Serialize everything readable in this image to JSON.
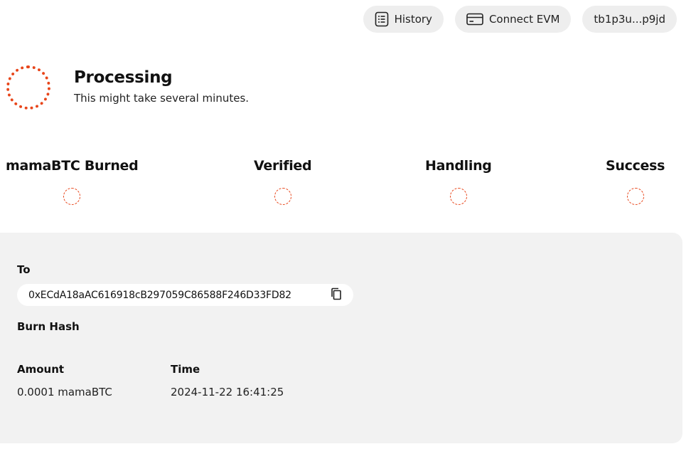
{
  "header": {
    "history_label": "History",
    "connect_label": "Connect EVM",
    "wallet_label": "tb1p3u...p9jd"
  },
  "status": {
    "title": "Processing",
    "subtitle": "This might take several minutes."
  },
  "steps": [
    {
      "label": "mamaBTC Burned"
    },
    {
      "label": "Verified"
    },
    {
      "label": "Handling"
    },
    {
      "label": "Success"
    }
  ],
  "details": {
    "to_label": "To",
    "to_address": "0xECdA18aAC616918cB297059C86588F246D33FD82",
    "burn_hash_label": "Burn Hash",
    "amount_label": "Amount",
    "amount_value": "0.0001 mamaBTC",
    "time_label": "Time",
    "time_value": "2024-11-22 16:41:25"
  },
  "colors": {
    "accent": "#e8461b",
    "pill_bg": "#eeeeee",
    "panel_bg": "#f2f2f2"
  },
  "icons": {
    "history": "list-document-icon",
    "connect": "card-icon",
    "copy": "copy-icon"
  }
}
